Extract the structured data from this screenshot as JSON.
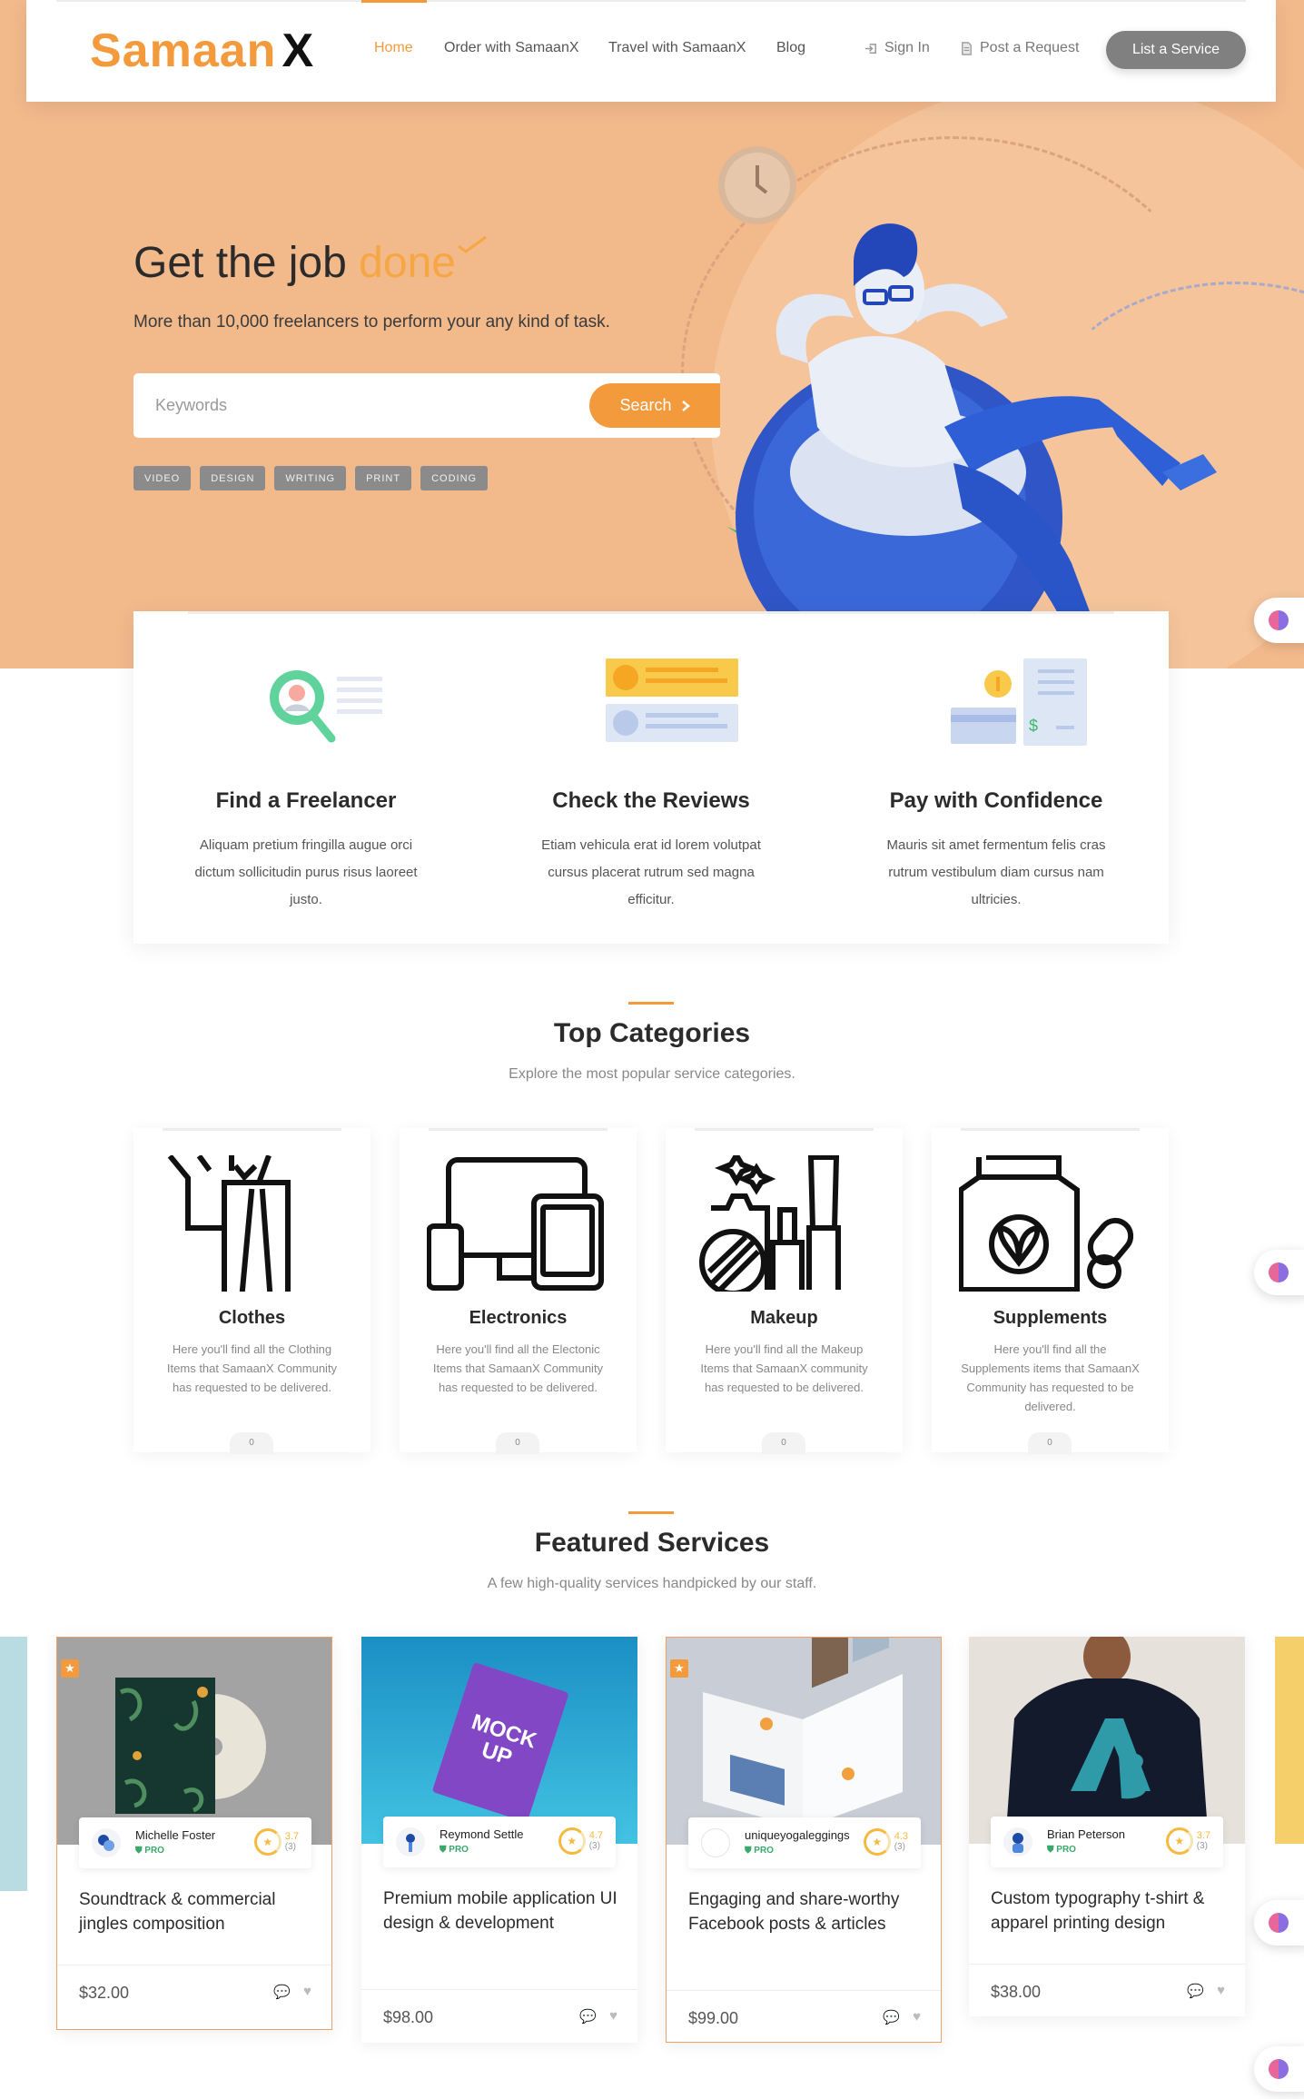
{
  "nav": {
    "logo_main": "Samaan",
    "logo_x": "X",
    "links": [
      "Home",
      "Order with SamaanX",
      "Travel with SamaanX",
      "Blog"
    ],
    "sign_in": "Sign In",
    "post_request": "Post a Request",
    "list_service": "List a Service"
  },
  "hero": {
    "title": "Get the job",
    "title_accent": "done",
    "subtitle": "More than 10,000 freelancers to perform your any kind of task.",
    "search_placeholder": "Keywords",
    "search_button": "Search",
    "tags": [
      "VIDEO",
      "DESIGN",
      "WRITING",
      "PRINT",
      "CODING"
    ]
  },
  "features": [
    {
      "title": "Find a Freelancer",
      "desc": "Aliquam pretium fringilla augue orci dictum sollicitudin purus risus laoreet justo.",
      "icon": "magnifier-icon"
    },
    {
      "title": "Check the Reviews",
      "desc": "Etiam vehicula erat id lorem volutpat cursus placerat rutrum sed magna efficitur.",
      "icon": "reviews-icon"
    },
    {
      "title": "Pay with Confidence",
      "desc": "Mauris sit amet fermentum felis cras rutrum vestibulum diam cursus nam ultricies.",
      "icon": "payment-icon"
    }
  ],
  "categories_section": {
    "title": "Top Categories",
    "subtitle": "Explore the most popular service categories."
  },
  "categories": [
    {
      "title": "Clothes",
      "desc": "Here you'll find all the Clothing Items that SamaanX Community has requested to be delivered.",
      "count": "0",
      "icon": "clothes-icon"
    },
    {
      "title": "Electronics",
      "desc": "Here you'll find all the Electonic Items that SamaanX Community has requested to be delivered.",
      "count": "0",
      "icon": "devices-icon"
    },
    {
      "title": "Makeup",
      "desc": "Here you'll find all the Makeup Items that SamaanX community has requested to be delivered.",
      "count": "0",
      "icon": "makeup-icon"
    },
    {
      "title": "Supplements",
      "desc": "Here you'll find all the Supplements items that SamaanX Community has requested to be delivered.",
      "count": "0",
      "icon": "supplements-icon"
    }
  ],
  "services_section": {
    "title": "Featured Services",
    "subtitle": "A few high-quality services handpicked by our staff."
  },
  "services": [
    {
      "author": "Michelle Foster",
      "badge": "PRO",
      "rating": "3.7",
      "reviews": "(3)",
      "title": "Soundtrack & commercial jingles composition",
      "price": "$32.00",
      "featured": true
    },
    {
      "author": "Reymond Settle",
      "badge": "PRO",
      "rating": "4.7",
      "reviews": "(3)",
      "title": "Premium mobile application UI design & development",
      "price": "$98.00",
      "featured": false
    },
    {
      "author": "uniqueyogaleggings",
      "badge": "PRO",
      "rating": "4.3",
      "reviews": "(3)",
      "title": "Engaging and share-worthy Facebook posts & articles",
      "price": "$99.00",
      "featured": true
    },
    {
      "author": "Brian Peterson",
      "badge": "PRO",
      "rating": "3.7",
      "reviews": "(3)",
      "title": "Custom typography t-shirt & apparel printing design",
      "price": "$38.00",
      "featured": false
    }
  ],
  "colors": {
    "accent": "#f39a3d",
    "hero_bg": "#f2b98b",
    "pro_green": "#3aa86b",
    "rating": "#f4b93e"
  }
}
